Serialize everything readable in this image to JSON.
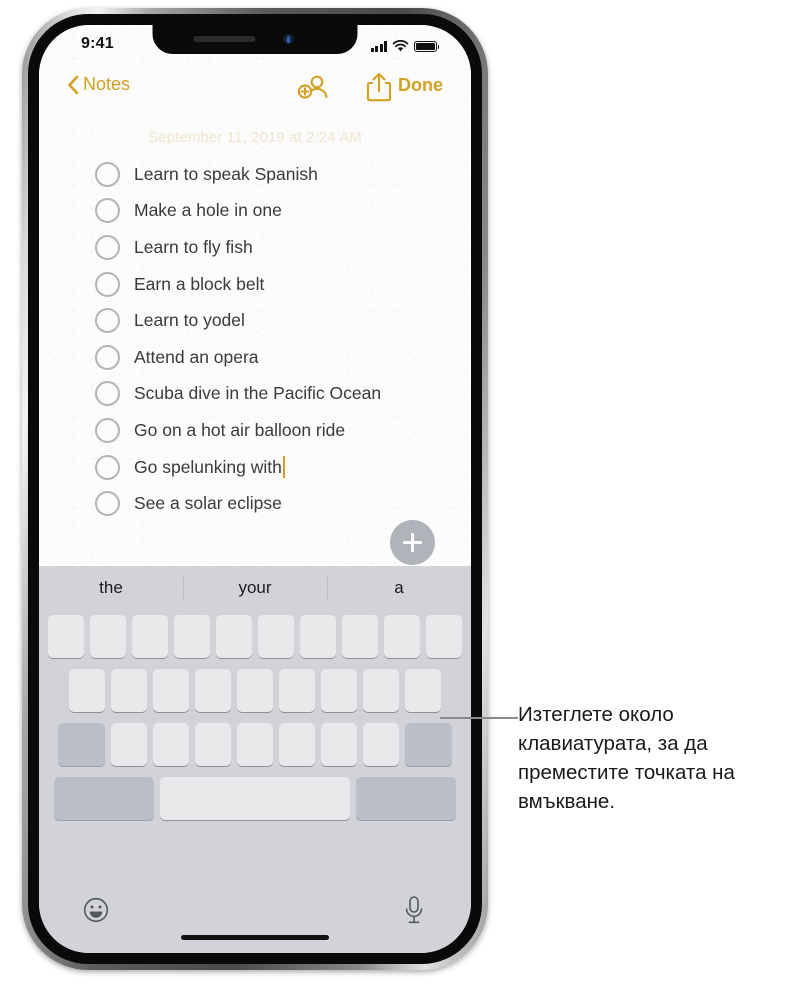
{
  "status_bar": {
    "time": "9:41",
    "cellular_icon": "signal-bars-icon",
    "wifi_icon": "wifi-icon",
    "battery_icon": "battery-icon"
  },
  "nav_bar": {
    "back_label": "Notes",
    "back_icon": "chevron-left-icon",
    "collaborate_icon": "add-person-icon",
    "share_icon": "share-icon",
    "done_label": "Done"
  },
  "note": {
    "date": "September 11, 2019 at 2:24 AM",
    "checklist": [
      {
        "text": "Learn to speak Spanish",
        "checked": false,
        "caret": false
      },
      {
        "text": "Make a hole in one",
        "checked": false,
        "caret": false
      },
      {
        "text": "Learn to fly fish",
        "checked": false,
        "caret": false
      },
      {
        "text": "Earn a block belt",
        "checked": false,
        "caret": false
      },
      {
        "text": "Learn to yodel",
        "checked": false,
        "caret": false
      },
      {
        "text": "Attend an opera",
        "checked": false,
        "caret": false
      },
      {
        "text": "Scuba dive in the Pacific Ocean",
        "checked": false,
        "caret": false
      },
      {
        "text": "Go on a hot air balloon ride",
        "checked": false,
        "caret": false
      },
      {
        "text": "Go spelunking with",
        "checked": false,
        "caret": true
      },
      {
        "text": "See a solar eclipse",
        "checked": false,
        "caret": false
      }
    ],
    "add_button_icon": "plus-icon"
  },
  "keyboard": {
    "suggestions": [
      "the",
      "your",
      "a"
    ],
    "emoji_icon": "emoji-smiley-icon",
    "dictation_icon": "microphone-icon",
    "home_indicator": "home-indicator",
    "row1_keys": 10,
    "row2_keys": 9,
    "row3_keys": 7,
    "note": "keys rendered blank (trackpad mode)"
  },
  "callout": {
    "text": "Изтеглете около клавиатурата, за да преместите точката на вмъкване.",
    "leader_line": "callout-leader-line"
  },
  "colors": {
    "accent_gold": "#d4a023",
    "paper": "#fcfcfc",
    "keyboard_bg": "#d1d3d9",
    "key_light": "#e8e9eb",
    "key_dark": "#bbbec6",
    "text": "#3a3a3c"
  }
}
